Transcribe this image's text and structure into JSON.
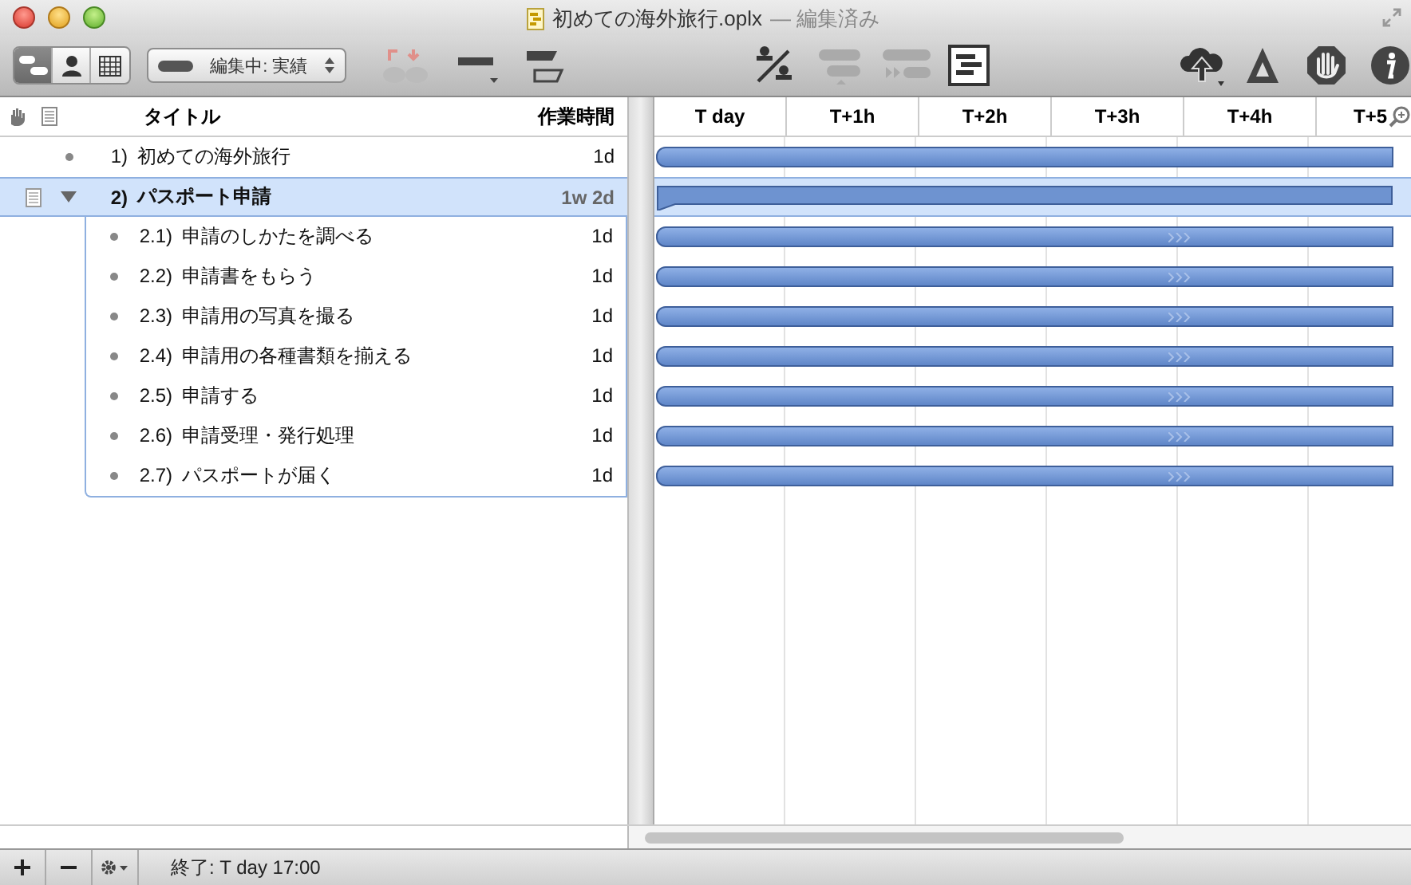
{
  "window": {
    "title": "初めての海外旅行.oplx",
    "edit_status": "— 編集済み"
  },
  "toolbar": {
    "view_modes": [
      {
        "kind": "gantt",
        "selected": true
      },
      {
        "kind": "resource",
        "selected": false
      },
      {
        "kind": "calendar",
        "selected": false
      }
    ],
    "mode_popup": "編集中: 実績"
  },
  "outline": {
    "columns": [
      "タイトル",
      "作業時間"
    ],
    "tasks": [
      {
        "number": "1)",
        "title": "初めての海外旅行",
        "effort": "1d",
        "selected": false
      },
      {
        "number": "2)",
        "title": "パスポート申請",
        "effort": "1w 2d",
        "selected": true,
        "expanded": true,
        "children": [
          {
            "number": "2.1)",
            "title": "申請のしかたを調べる",
            "effort": "1d",
            "selected": false
          },
          {
            "number": "2.2)",
            "title": "申請書をもらう",
            "effort": "1d",
            "selected": false
          },
          {
            "number": "2.3)",
            "title": "申請用の写真を撮る",
            "effort": "1d",
            "selected": false
          },
          {
            "number": "2.4)",
            "title": "申請用の各種書類を揃える",
            "effort": "1d",
            "selected": false
          },
          {
            "number": "2.5)",
            "title": "申請する",
            "effort": "1d",
            "selected": false
          },
          {
            "number": "2.6)",
            "title": "申請受理・発行処理",
            "effort": "1d",
            "selected": false
          },
          {
            "number": "2.7)",
            "title": "パスポートが届く",
            "effort": "1d",
            "selected": false
          }
        ]
      }
    ]
  },
  "gantt": {
    "columns": [
      "T day",
      "T+1h",
      "T+2h",
      "T+3h",
      "T+4h",
      "T+5"
    ]
  },
  "status_bar": {
    "text": "終了: T day 17:00"
  }
}
